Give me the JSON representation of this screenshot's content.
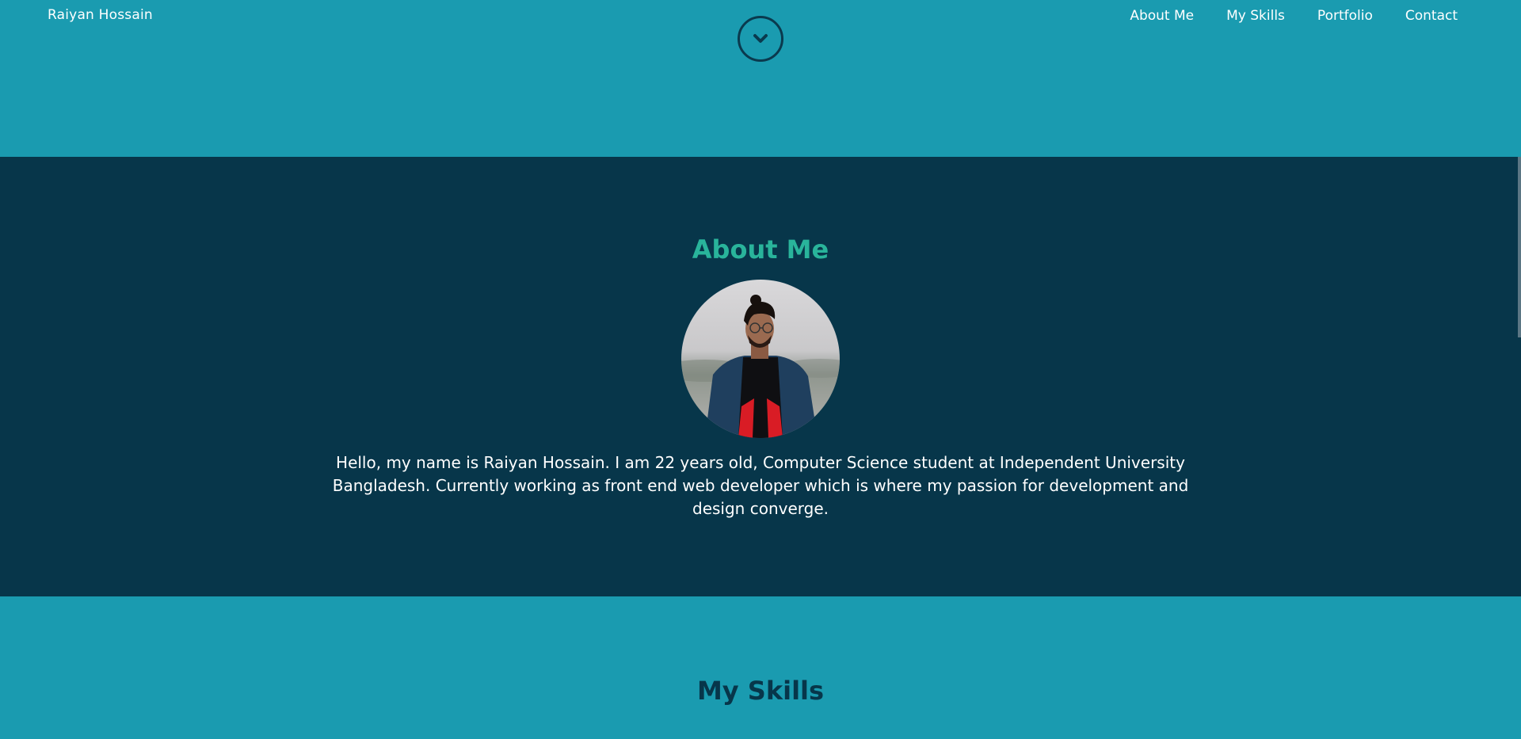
{
  "header": {
    "brand": "Raiyan Hossain",
    "nav": [
      "About Me",
      "My Skills",
      "Portfolio",
      "Contact"
    ],
    "scroll_icon": "chevron-down-icon"
  },
  "about": {
    "title": "About Me",
    "text": "Hello, my name is Raiyan Hossain. I am 22 years old, Computer Science student at Independent University Bangladesh. Currently working as front end web developer which is where my passion for development and design converge."
  },
  "skills": {
    "title": "My Skills"
  },
  "colors": {
    "hero_bg": "#1a9bb0",
    "about_bg": "#07364a",
    "accent": "#29b49b",
    "text_light": "#ffffff"
  }
}
